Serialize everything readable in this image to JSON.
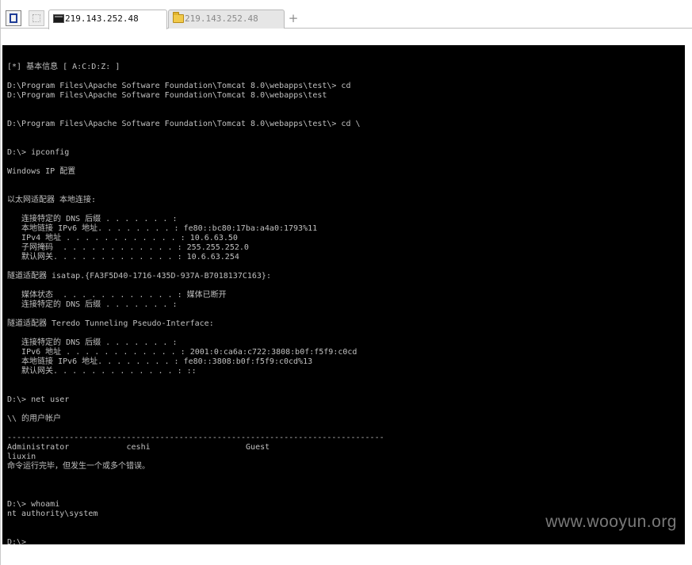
{
  "tabs": [
    {
      "label": "219.143.252.48",
      "icon": "terminal-icon",
      "active": true
    },
    {
      "label": "219.143.252.48",
      "icon": "folder-icon",
      "active": false
    }
  ],
  "tabbar": {
    "add_tab_label": "+"
  },
  "terminal": {
    "lines": [
      "",
      "[*] 基本信息 [ A:C:D:Z: ]",
      "",
      "D:\\Program Files\\Apache Software Foundation\\Tomcat 8.0\\webapps\\test\\> cd",
      "D:\\Program Files\\Apache Software Foundation\\Tomcat 8.0\\webapps\\test",
      "",
      "",
      "D:\\Program Files\\Apache Software Foundation\\Tomcat 8.0\\webapps\\test\\> cd \\",
      "",
      "",
      "D:\\> ipconfig",
      "",
      "Windows IP 配置",
      "",
      "",
      "以太网适配器 本地连接:",
      "",
      "   连接特定的 DNS 后缀 . . . . . . . :",
      "   本地链接 IPv6 地址. . . . . . . . : fe80::bc80:17ba:a4a0:1793%11",
      "   IPv4 地址 . . . . . . . . . . . . : 10.6.63.50",
      "   子网掩码  . . . . . . . . . . . . : 255.255.252.0",
      "   默认网关. . . . . . . . . . . . . : 10.6.63.254",
      "",
      "隧道适配器 isatap.{FA3F5D40-1716-435D-937A-B7018137C163}:",
      "",
      "   媒体状态  . . . . . . . . . . . . : 媒体已断开",
      "   连接特定的 DNS 后缀 . . . . . . . :",
      "",
      "隧道适配器 Teredo Tunneling Pseudo-Interface:",
      "",
      "   连接特定的 DNS 后缀 . . . . . . . :",
      "   IPv6 地址 . . . . . . . . . . . . : 2001:0:ca6a:c722:3808:b0f:f5f9:c0cd",
      "   本地链接 IPv6 地址. . . . . . . . : fe80::3808:b0f:f5f9:c0cd%13",
      "   默认网关. . . . . . . . . . . . . : ::",
      "",
      "",
      "D:\\> net user",
      "",
      "\\\\ 的用户帐户",
      "",
      "-------------------------------------------------------------------------------",
      "Administrator            ceshi                    Guest",
      "liuxin",
      "命令运行完毕，但发生一个或多个错误。",
      "",
      "",
      "",
      "D:\\> whoami",
      "nt authority\\system",
      "",
      "",
      "D:\\>"
    ]
  },
  "watermark": "www.wooyun.org"
}
